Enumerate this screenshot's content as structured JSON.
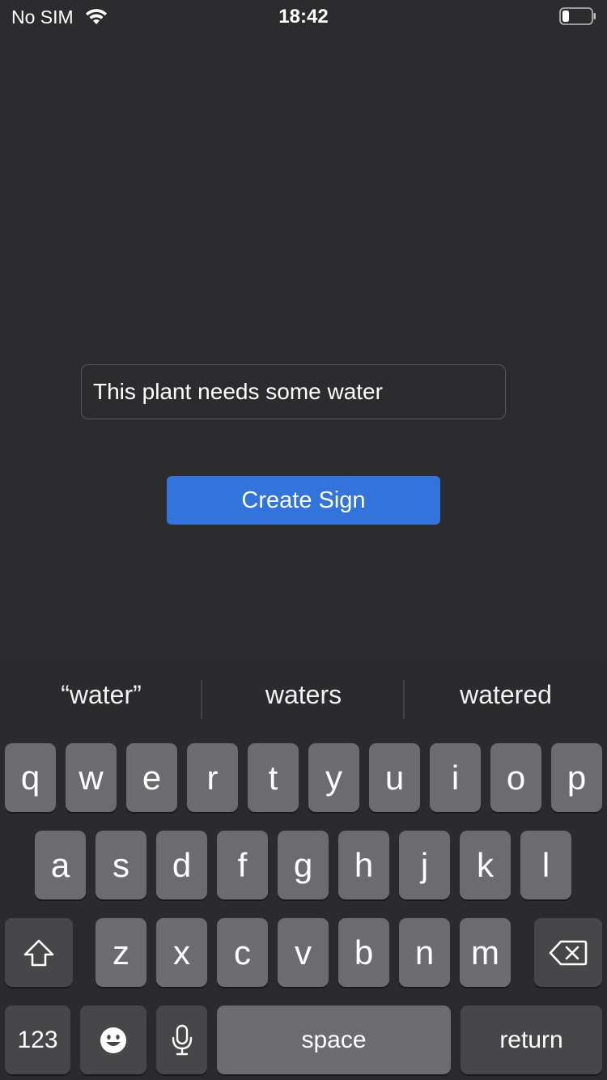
{
  "status_bar": {
    "carrier": "No SIM",
    "time": "18:42",
    "wifi_icon": "wifi-icon",
    "battery_icon": "battery-icon"
  },
  "form": {
    "text_field_value": "This plant needs some water",
    "create_button_label": "Create Sign",
    "accent_color": "#3273dc"
  },
  "keyboard": {
    "suggestions": [
      "“water”",
      "waters",
      "watered"
    ],
    "row1": [
      "q",
      "w",
      "e",
      "r",
      "t",
      "y",
      "u",
      "i",
      "o",
      "p"
    ],
    "row2": [
      "a",
      "s",
      "d",
      "f",
      "g",
      "h",
      "j",
      "k",
      "l"
    ],
    "row3": [
      "z",
      "x",
      "c",
      "v",
      "b",
      "n",
      "m"
    ],
    "numbers_label": "123",
    "space_label": "space",
    "return_label": "return",
    "shift_icon": "shift-icon",
    "delete_icon": "backspace-icon",
    "emoji_icon": "emoji-icon",
    "mic_icon": "microphone-icon"
  }
}
